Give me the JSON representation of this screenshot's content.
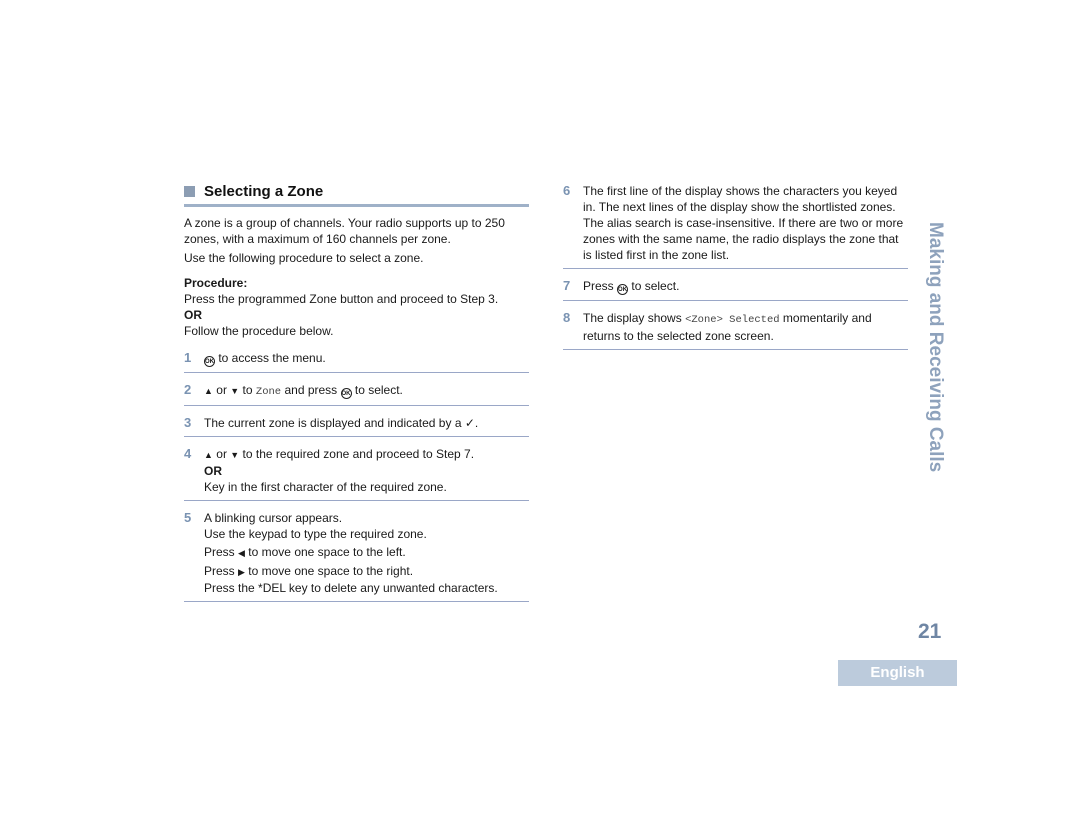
{
  "section": {
    "title": "Selecting a Zone",
    "intro": "A zone is a group of channels. Your radio supports up to 250 zones, with a maximum of 160 channels per zone.",
    "intro2": "Use the following procedure to select a zone.",
    "procedure_label": "Procedure:",
    "procedure_alt1": "Press the programmed Zone button and proceed to Step 3.",
    "or_label": "OR",
    "procedure_alt2": "Follow the procedure below."
  },
  "steps": [
    {
      "num": "1",
      "text": "to access the menu.",
      "icon": "ok-menu-button-icon"
    },
    {
      "num": "2",
      "pre": "or",
      "mid": "to",
      "mono": "Zone",
      "post": "and press",
      "end": "to select."
    },
    {
      "num": "3",
      "text": "The current zone is displayed and indicated by a",
      "check": "✓",
      "end": "."
    },
    {
      "num": "4",
      "pre": "or",
      "text": "to the required zone and proceed to Step 7.",
      "or": "OR",
      "alt": "Key in the first character of the required zone."
    },
    {
      "num": "5",
      "lines": [
        "A blinking cursor appears.",
        "Use the keypad to type the required zone."
      ],
      "press": "Press",
      "left_text": "to move one space to the left.",
      "right_text": "to move one space to the right.",
      "del": "Press the *DEL key to delete any unwanted characters."
    },
    {
      "num": "6",
      "text": "The first line of the display shows the characters you keyed in. The next lines of the display show the shortlisted zones. The alias search is case-insensitive. If there are two or more zones with the same name, the radio displays the zone that is listed first in the zone list."
    },
    {
      "num": "7",
      "pre": "Press",
      "post": "to select."
    },
    {
      "num": "8",
      "pre": "The display shows",
      "mono": "<Zone> Selected",
      "post": "momentarily and returns to the selected zone screen."
    }
  ],
  "sidebar": {
    "chapter": "Making and Receiving Calls"
  },
  "footer": {
    "page_number": "21",
    "language": "English"
  },
  "colors": {
    "accent": "#7a93b2",
    "rule": "#9aa7c7",
    "tab": "#bccbdc"
  }
}
